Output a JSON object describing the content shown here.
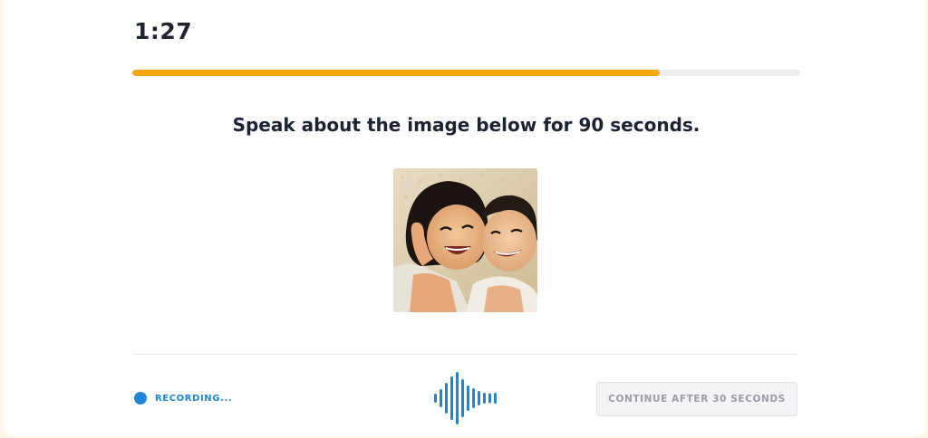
{
  "timer": {
    "value": "1:27"
  },
  "progress": {
    "fraction": 0.79,
    "fill_color": "#f5a60a"
  },
  "prompt": {
    "text": "Speak about the image below for 90 seconds."
  },
  "photo": {
    "subject": "two-laughing-children-photo"
  },
  "recording": {
    "label": "RECORDING...",
    "color": "#1f86d6"
  },
  "waveform": {
    "icon": "audio-waveform-icon",
    "color": "#1f86d6"
  },
  "footer": {
    "continue_label": "CONTINUE AFTER 30 SECONDS"
  }
}
